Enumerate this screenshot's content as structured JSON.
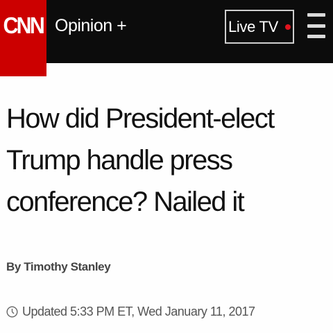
{
  "brand": {
    "logo_text": "CNN",
    "colors": {
      "logo_bg": "#cc0000",
      "nav_bg": "#0c0c0c",
      "live_dot": "#e0141e"
    }
  },
  "nav": {
    "section_label": "Opinion +",
    "live_tv_label": "Live TV",
    "menu_icon": "hamburger-menu-icon"
  },
  "article": {
    "headline": "How did President-elect Trump handle press conference? Nailed it",
    "byline": "By Timothy Stanley",
    "timestamp": "Updated 5:33 PM ET, Wed January 11, 2017",
    "timestamp_icon": "clock-icon"
  }
}
